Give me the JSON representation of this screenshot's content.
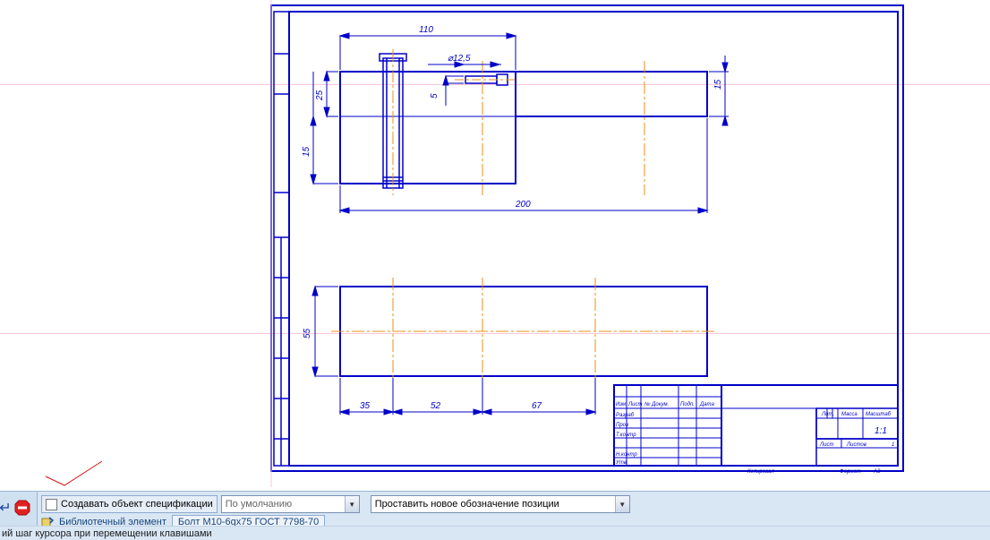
{
  "drawing": {
    "dims": {
      "top_110": "110",
      "diam_125": "⌀12,5",
      "v5": "5",
      "v25": "25",
      "v15_left": "15",
      "v15_right": "15",
      "h200": "200",
      "v55": "55",
      "h35": "35",
      "h52": "52",
      "h67": "67"
    },
    "titleblock": {
      "r0c0": "Изм",
      "r0c1": "Лист",
      "r0c2": "№ Докум.",
      "r0c3": "Подп.",
      "r0c4": "Дата",
      "r1": "Разраб",
      "r2": "Пров",
      "r3": "Т.контр",
      "r5": "Н.контр",
      "r6": "Утв",
      "h_lit": "Лит.",
      "h_mass": "Масса",
      "h_scale": "Масштаб",
      "scale": "1:1",
      "h_list": "Лист",
      "h_listov": "Листов",
      "listov_v": "1",
      "format": "Формат",
      "format_v": "A3",
      "kopir": "Копировал"
    }
  },
  "panel": {
    "create_spec_label": "Создавать объект спецификации",
    "combo1_value": "По умолчанию",
    "combo2_value": "Проставить новое обозначение позиции",
    "lib_label": "Библиотечный элемент",
    "lib_value": "Болт М10-6gx75 ГОСТ 7798-70"
  },
  "status": {
    "text": "ий шаг курсора при перемещении клавишами"
  }
}
